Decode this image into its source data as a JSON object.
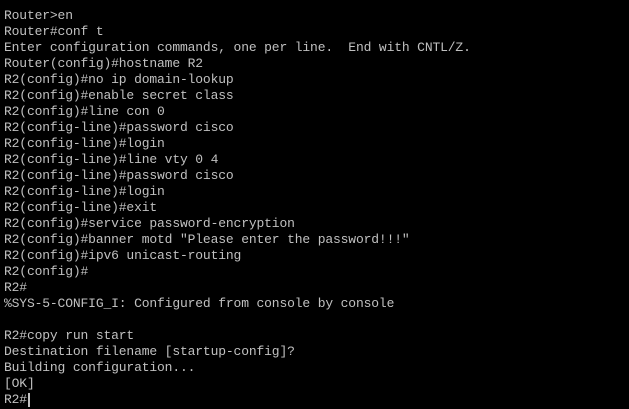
{
  "terminal": {
    "lines": [
      "Router>en",
      "Router#conf t",
      "Enter configuration commands, one per line.  End with CNTL/Z.",
      "Router(config)#hostname R2",
      "R2(config)#no ip domain-lookup",
      "R2(config)#enable secret class",
      "R2(config)#line con 0",
      "R2(config-line)#password cisco",
      "R2(config-line)#login",
      "R2(config-line)#line vty 0 4",
      "R2(config-line)#password cisco",
      "R2(config-line)#login",
      "R2(config-line)#exit",
      "R2(config)#service password-encryption",
      "R2(config)#banner motd \"Please enter the password!!!\"",
      "R2(config)#ipv6 unicast-routing",
      "R2(config)#",
      "R2#",
      "%SYS-5-CONFIG_I: Configured from console by console",
      "",
      "R2#copy run start",
      "Destination filename [startup-config]?",
      "Building configuration...",
      "[OK]"
    ],
    "current_prompt": "R2#",
    "text_color": "#c0c0c0",
    "background_color": "#000000"
  }
}
